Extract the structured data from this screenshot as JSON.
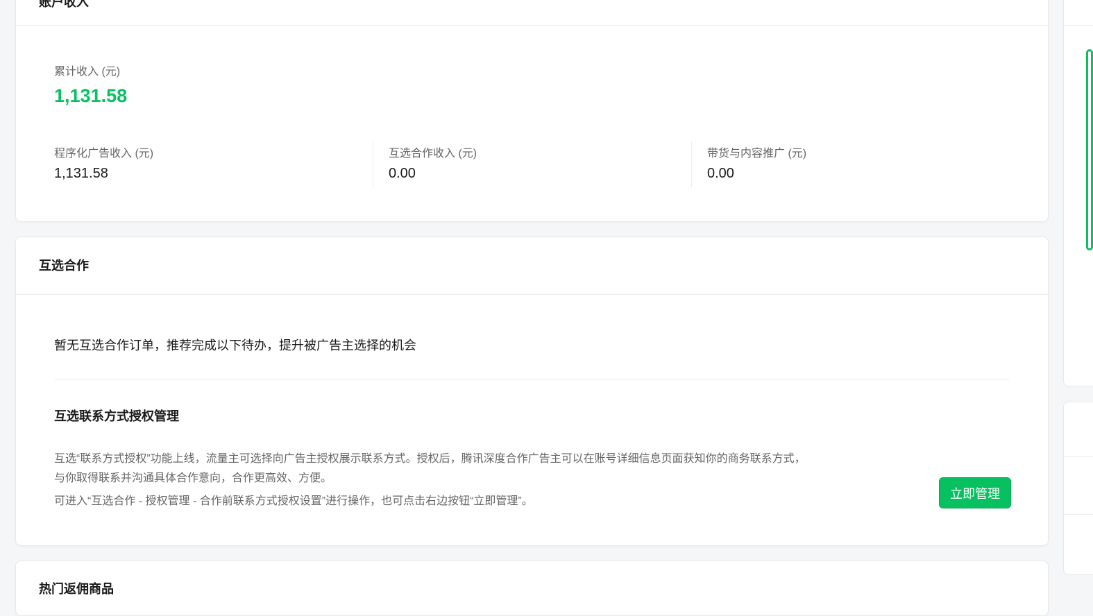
{
  "income": {
    "title": "账户收入",
    "total_label": "累计收入 (元)",
    "total_value": "1,131.58",
    "items": [
      {
        "label": "程序化广告收入 (元)",
        "value": "1,131.58"
      },
      {
        "label": "互选合作收入 (元)",
        "value": "0.00"
      },
      {
        "label": "带货与内容推广 (元)",
        "value": "0.00"
      }
    ]
  },
  "mutual": {
    "title": "互选合作",
    "empty_text": "暂无互选合作订单，推荐完成以下待办，提升被广告主选择的机会",
    "auth_title": "互选联系方式授权管理",
    "auth_desc_1": "互选“联系方式授权”功能上线，流量主可选择向广告主授权展示联系方式。授权后，腾讯深度合作广告主可以在账号详细信息页面获知你的商务联系方式，",
    "auth_desc_2": "与你取得联系并沟通具体合作意向，合作更高效、方便。",
    "auth_desc_3": "可进入“互选合作 - 授权管理 - 合作前联系方式授权设置”进行操作，也可点击右边按钮“立即管理”。",
    "manage_button": "立即管理"
  },
  "hot": {
    "title": "热门返佣商品"
  },
  "colors": {
    "accent": "#07c160"
  }
}
